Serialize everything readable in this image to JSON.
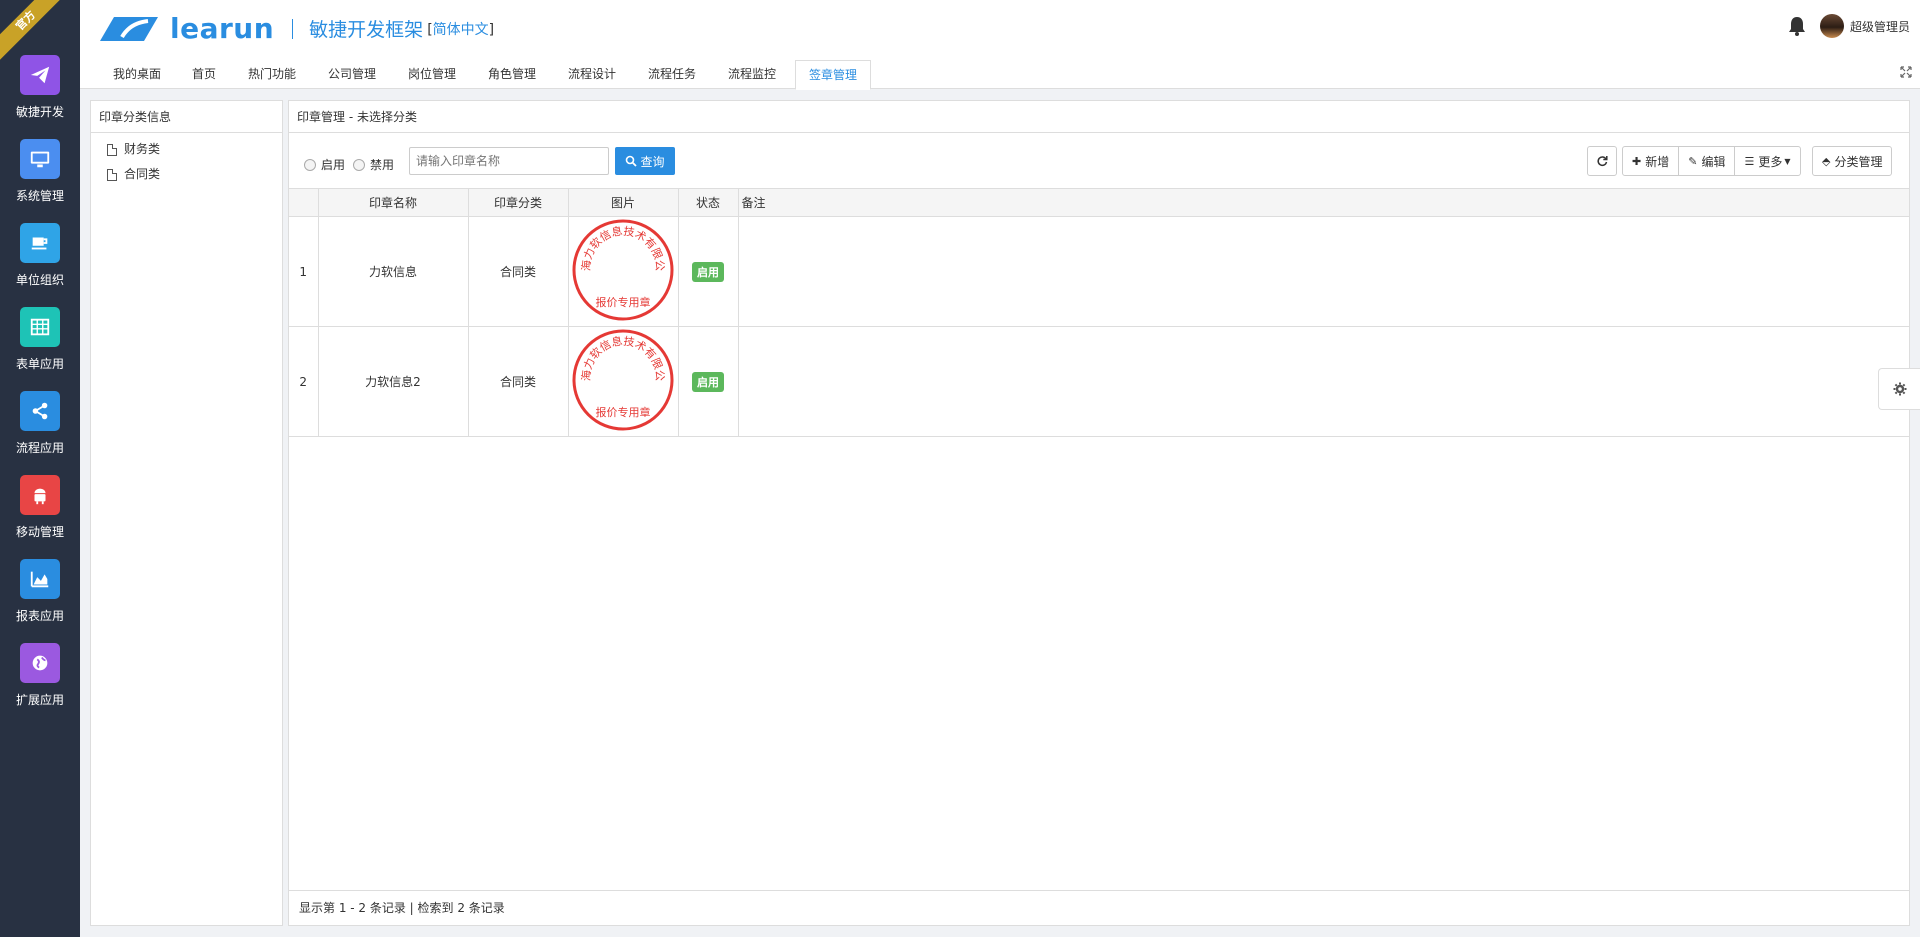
{
  "badge_ribbon": "官方",
  "sidebar": {
    "items": [
      {
        "label": "敏捷开发",
        "icon": "paper-plane-icon",
        "color": "#8f54e6"
      },
      {
        "label": "系统管理",
        "icon": "monitor-icon",
        "color": "#4b8ef0"
      },
      {
        "label": "单位组织",
        "icon": "coffee-icon",
        "color": "#2fa4e7"
      },
      {
        "label": "表单应用",
        "icon": "table-icon",
        "color": "#1ec3b6"
      },
      {
        "label": "流程应用",
        "icon": "share-icon",
        "color": "#2a8de0"
      },
      {
        "label": "移动管理",
        "icon": "android-icon",
        "color": "#e84545"
      },
      {
        "label": "报表应用",
        "icon": "area-chart-icon",
        "color": "#2a8de0"
      },
      {
        "label": "扩展应用",
        "icon": "globe-icon",
        "color": "#9b59e0"
      }
    ]
  },
  "header": {
    "logo_text": "learun",
    "title": "敏捷开发框架",
    "lang_open": "[",
    "lang": "简体中文",
    "lang_close": "]",
    "user_name": "超级管理员"
  },
  "tabs": [
    {
      "label": "我的桌面"
    },
    {
      "label": "首页"
    },
    {
      "label": "热门功能"
    },
    {
      "label": "公司管理"
    },
    {
      "label": "岗位管理"
    },
    {
      "label": "角色管理"
    },
    {
      "label": "流程设计"
    },
    {
      "label": "流程任务"
    },
    {
      "label": "流程监控"
    },
    {
      "label": "签章管理",
      "active": true
    }
  ],
  "category_panel": {
    "title": "印章分类信息",
    "items": [
      "财务类",
      "合同类"
    ]
  },
  "main": {
    "title": "印章管理 - 未选择分类",
    "radio_enabled": "启用",
    "radio_disabled": "禁用",
    "search_placeholder": "请输入印章名称",
    "search_label": "查询",
    "add_label": "新增",
    "edit_label": "编辑",
    "more_label": "更多",
    "category_manage_label": "分类管理"
  },
  "table": {
    "headers": [
      "",
      "印章名称",
      "印章分类",
      "图片",
      "状态",
      "备注"
    ],
    "rows": [
      {
        "no": "1",
        "name": "力软信息",
        "category": "合同类",
        "status": "启用",
        "note": ""
      },
      {
        "no": "2",
        "name": "力软信息2",
        "category": "合同类",
        "status": "启用",
        "note": ""
      }
    ]
  },
  "stamp": {
    "company_text": "上海力软信息技术有限公司",
    "bottom_text": "报价专用章",
    "color": "#e53935"
  },
  "footer": {
    "text": "显示第 1 - 2 条记录 | 检索到 2 条记录"
  }
}
